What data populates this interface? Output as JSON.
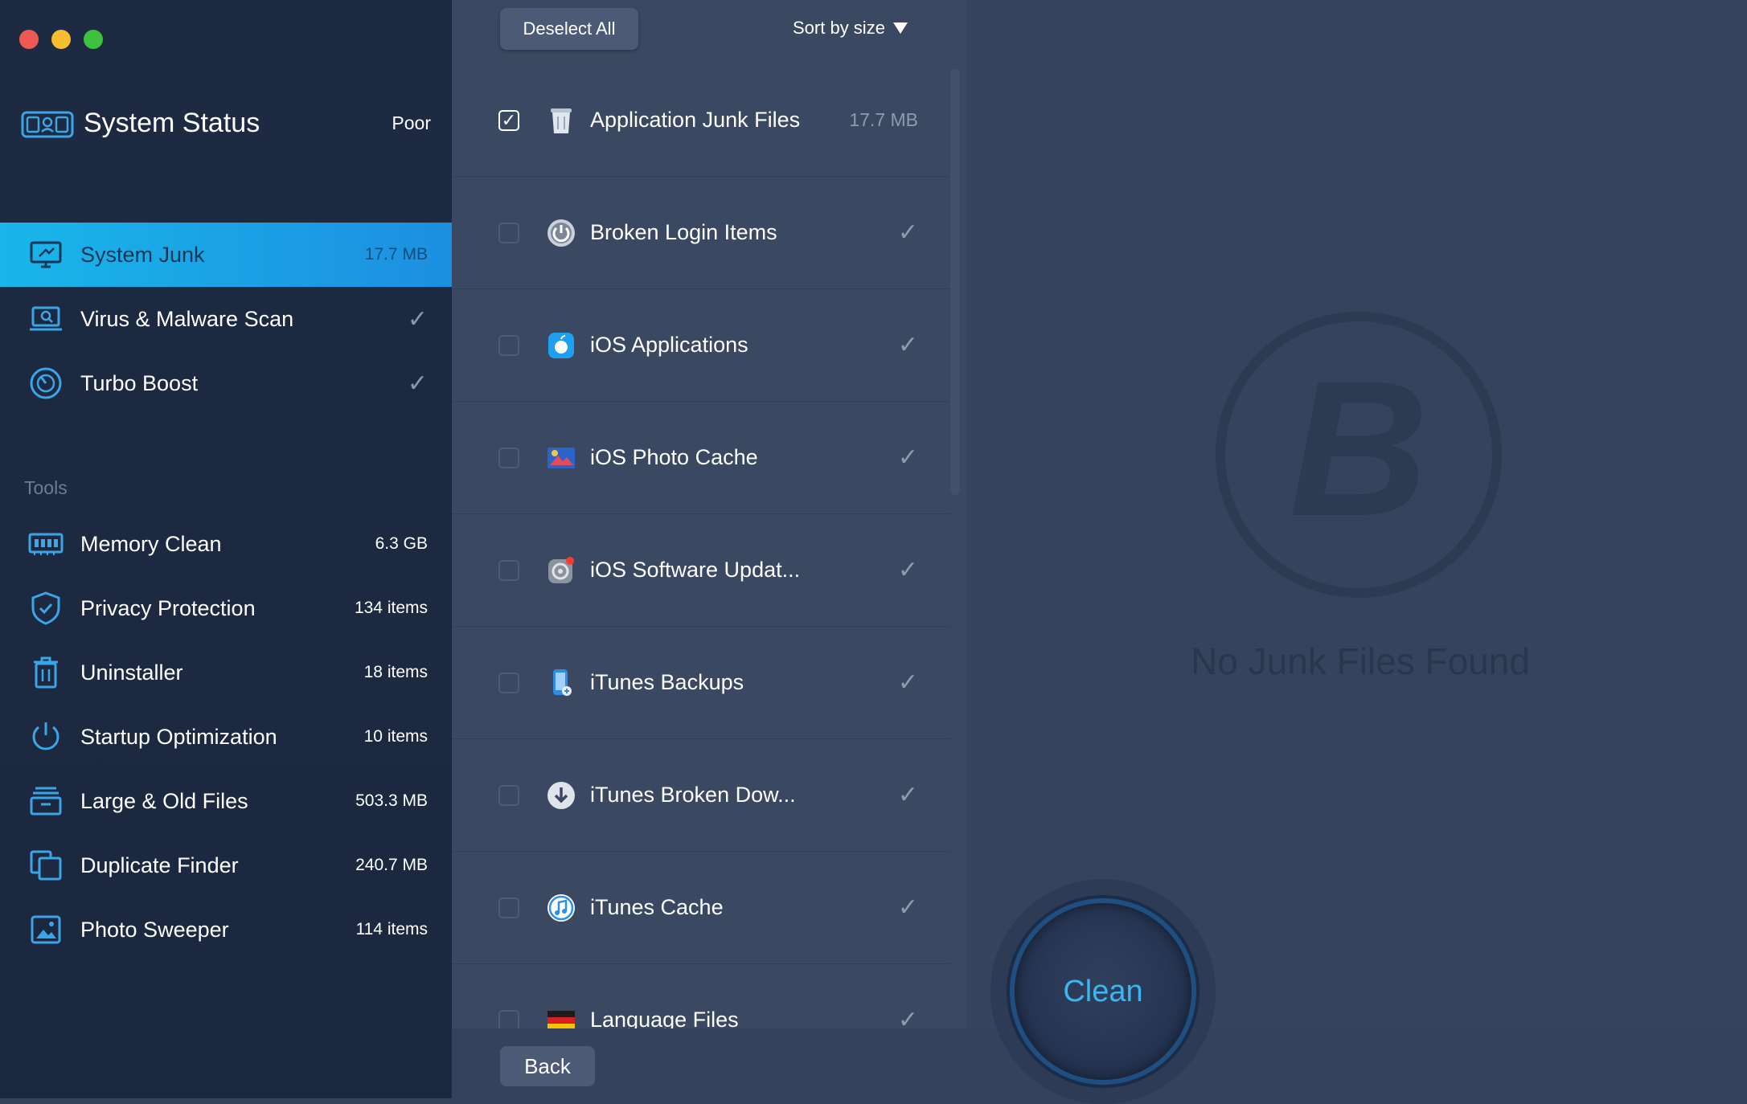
{
  "sidebar": {
    "status": {
      "title": "System Status",
      "value": "Poor"
    },
    "nav": [
      {
        "label": "System Junk",
        "value": "17.7 MB",
        "icon": "monitor-icon",
        "active": true
      },
      {
        "label": "Virus & Malware Scan",
        "value": "✓",
        "icon": "laptop-scan-icon"
      },
      {
        "label": "Turbo Boost",
        "value": "✓",
        "icon": "speedometer-icon"
      }
    ],
    "tools_label": "Tools",
    "tools": [
      {
        "label": "Memory Clean",
        "value": "6.3 GB",
        "icon": "memory-icon"
      },
      {
        "label": "Privacy Protection",
        "value": "134 items",
        "icon": "shield-icon"
      },
      {
        "label": "Uninstaller",
        "value": "18 items",
        "icon": "trash-icon"
      },
      {
        "label": "Startup Optimization",
        "value": "10 items",
        "icon": "power-icon"
      },
      {
        "label": "Large & Old Files",
        "value": "503.3 MB",
        "icon": "drawer-icon"
      },
      {
        "label": "Duplicate Finder",
        "value": "240.7 MB",
        "icon": "duplicate-icon"
      },
      {
        "label": "Photo Sweeper",
        "value": "114 items",
        "icon": "photo-icon"
      }
    ]
  },
  "toolbar": {
    "deselect_label": "Deselect All",
    "sort_label": "Sort by size"
  },
  "list": [
    {
      "name": "Application Junk Files",
      "size": "17.7 MB",
      "checked": true,
      "icon": "trash-can-icon"
    },
    {
      "name": "Broken Login Items",
      "size": "✓",
      "checked": false,
      "icon": "power-button-icon"
    },
    {
      "name": "iOS Applications",
      "size": "✓",
      "checked": false,
      "icon": "app-store-icon"
    },
    {
      "name": "iOS Photo Cache",
      "size": "✓",
      "checked": false,
      "icon": "photo-cache-icon"
    },
    {
      "name": "iOS Software Updat...",
      "size": "✓",
      "checked": false,
      "icon": "settings-gear-icon"
    },
    {
      "name": "iTunes Backups",
      "size": "✓",
      "checked": false,
      "icon": "phone-backup-icon"
    },
    {
      "name": "iTunes Broken Dow...",
      "size": "✓",
      "checked": false,
      "icon": "download-icon"
    },
    {
      "name": "iTunes Cache",
      "size": "✓",
      "checked": false,
      "icon": "music-note-icon"
    },
    {
      "name": "Language Files",
      "size": "✓",
      "checked": false,
      "icon": "flag-icon"
    }
  ],
  "back_label": "Back",
  "empty_state": {
    "text": "No Junk Files Found",
    "logo_letter": "B"
  },
  "clean_label": "Clean",
  "colors": {
    "accent": "#19b6ea",
    "sidebar_bg": "#1d2a41",
    "panel_bg": "#3a4862",
    "clean_text": "#3db5f0"
  }
}
